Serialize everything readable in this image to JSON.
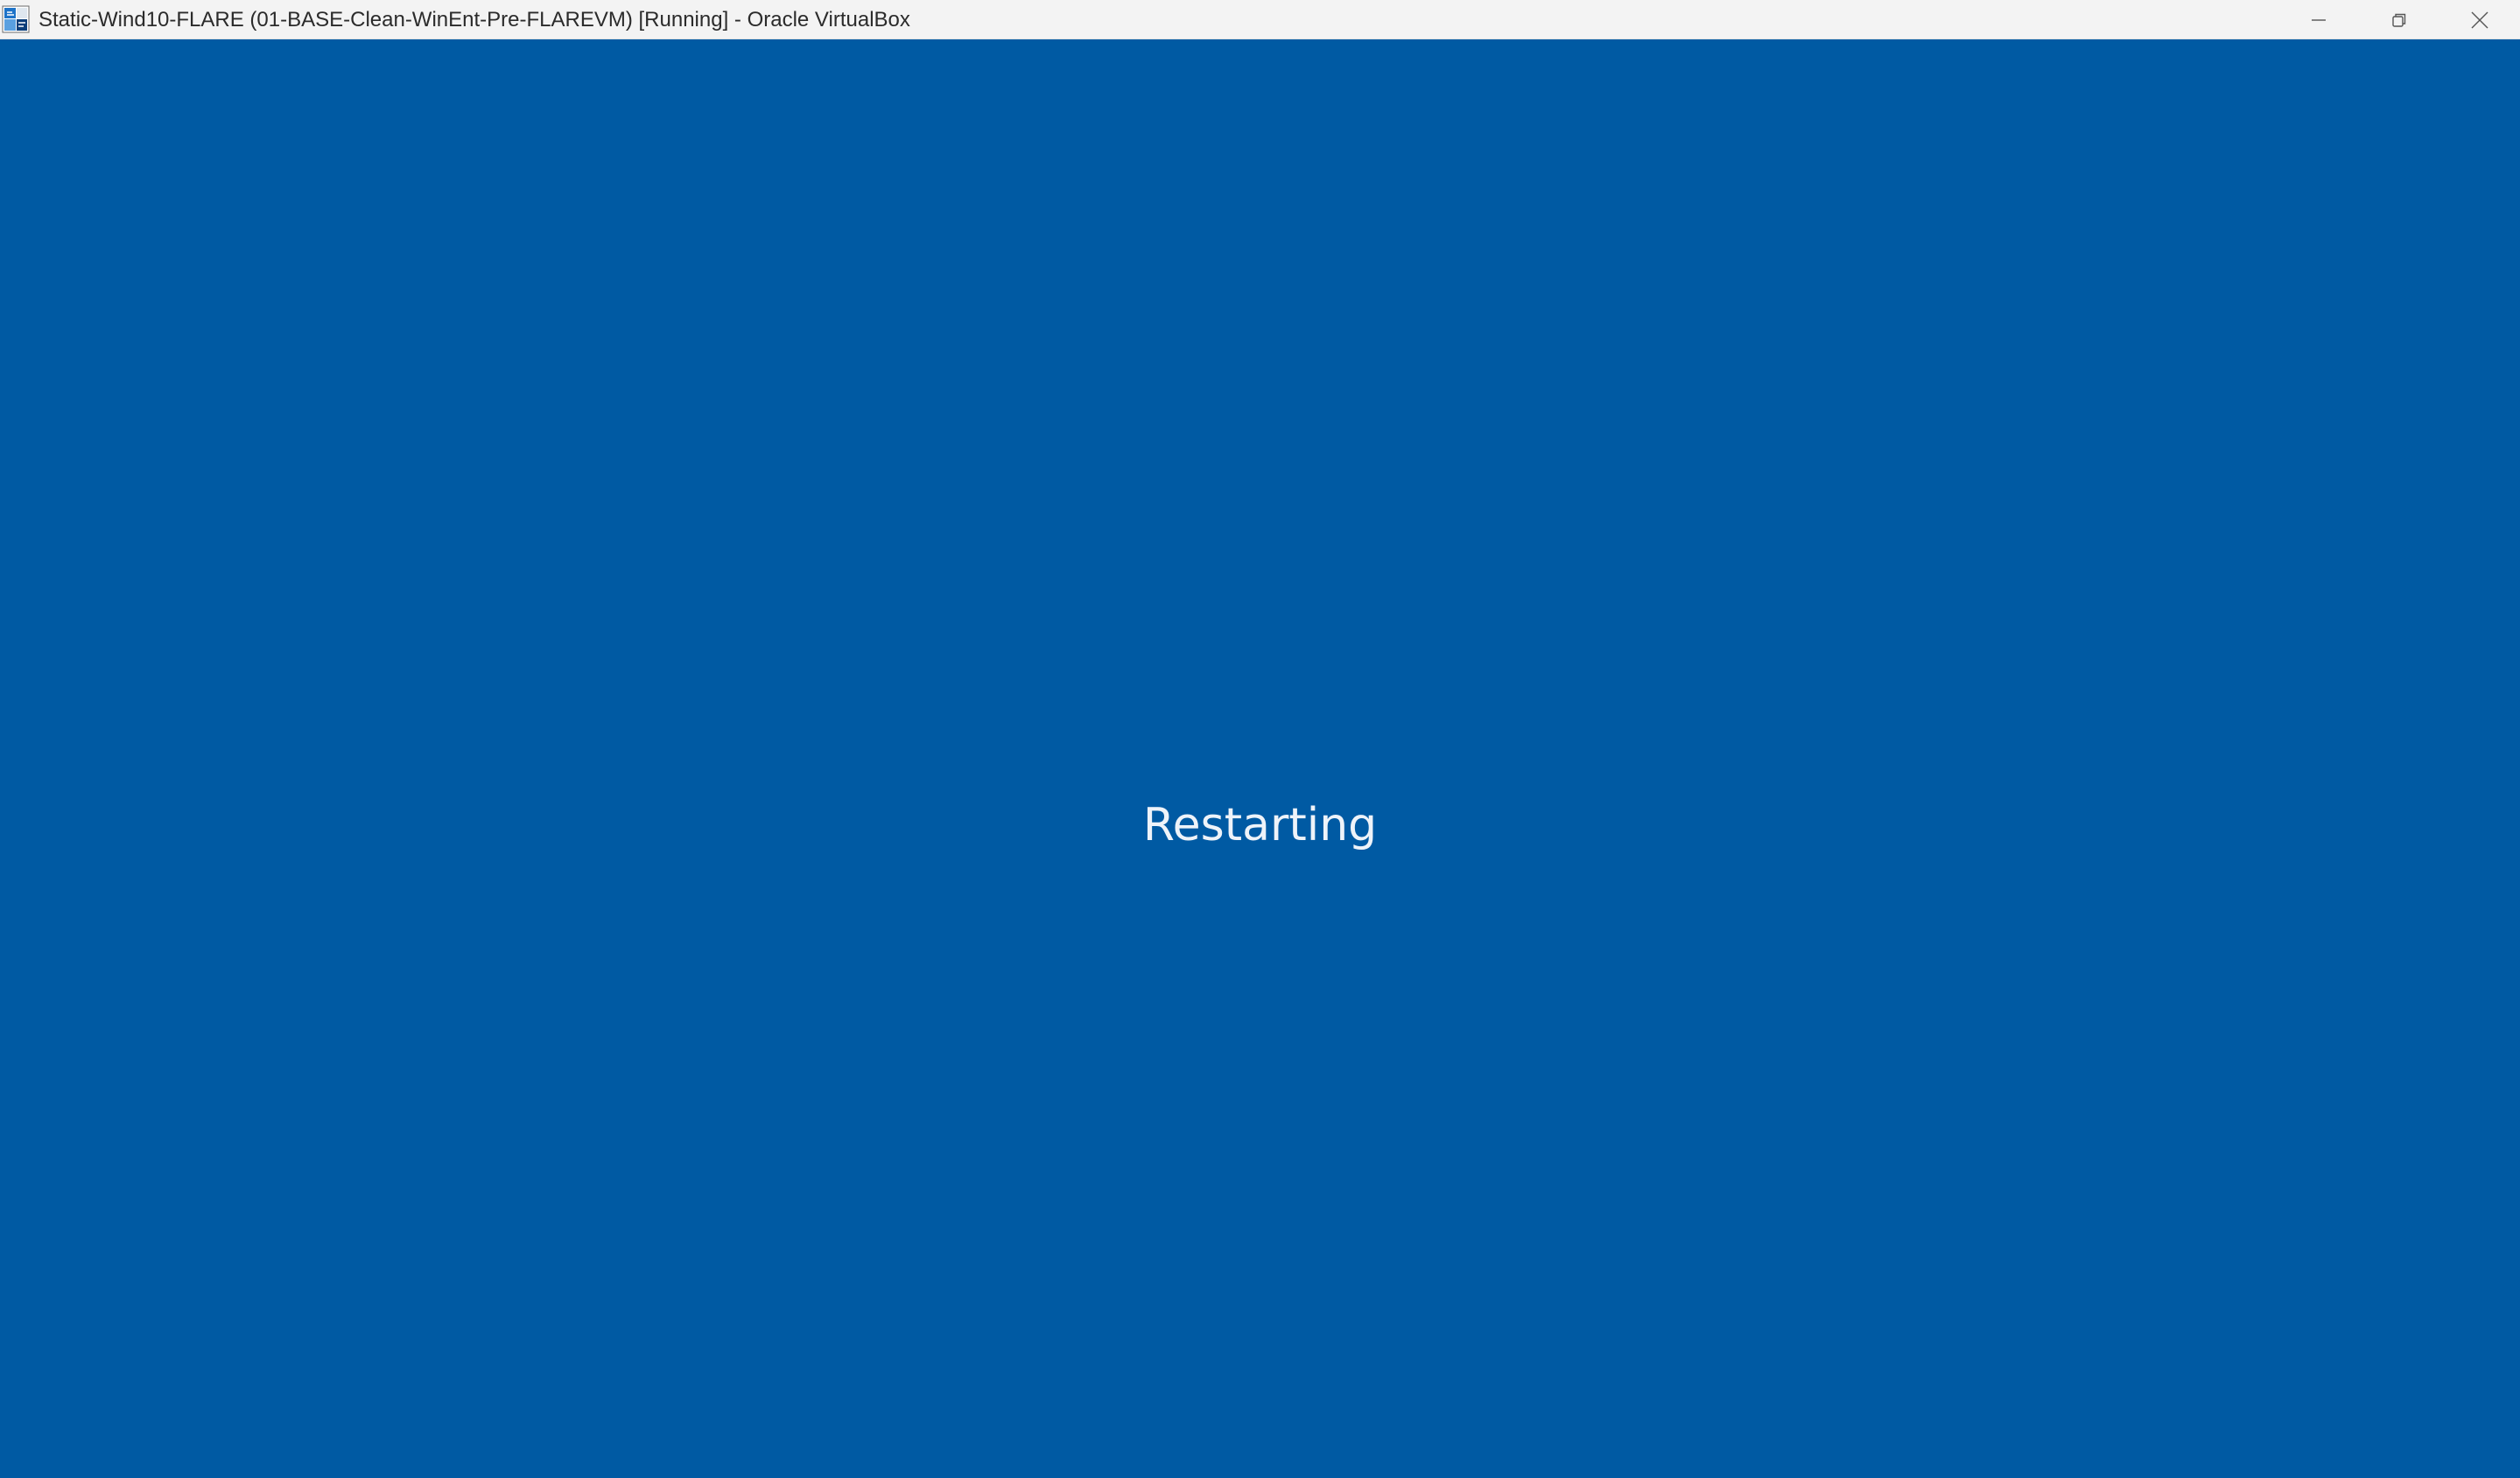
{
  "window": {
    "title": "Static-Wind10-FLARE (01-BASE-Clean-WinEnt-Pre-FLAREVM) [Running] - Oracle VirtualBox",
    "icon": "virtualbox-app-icon",
    "controls": {
      "minimize_icon": "minimize-icon",
      "restore_icon": "restore-icon",
      "close_icon": "close-icon"
    }
  },
  "guest_screen": {
    "background_color": "#005aa3",
    "status_text": "Restarting"
  }
}
